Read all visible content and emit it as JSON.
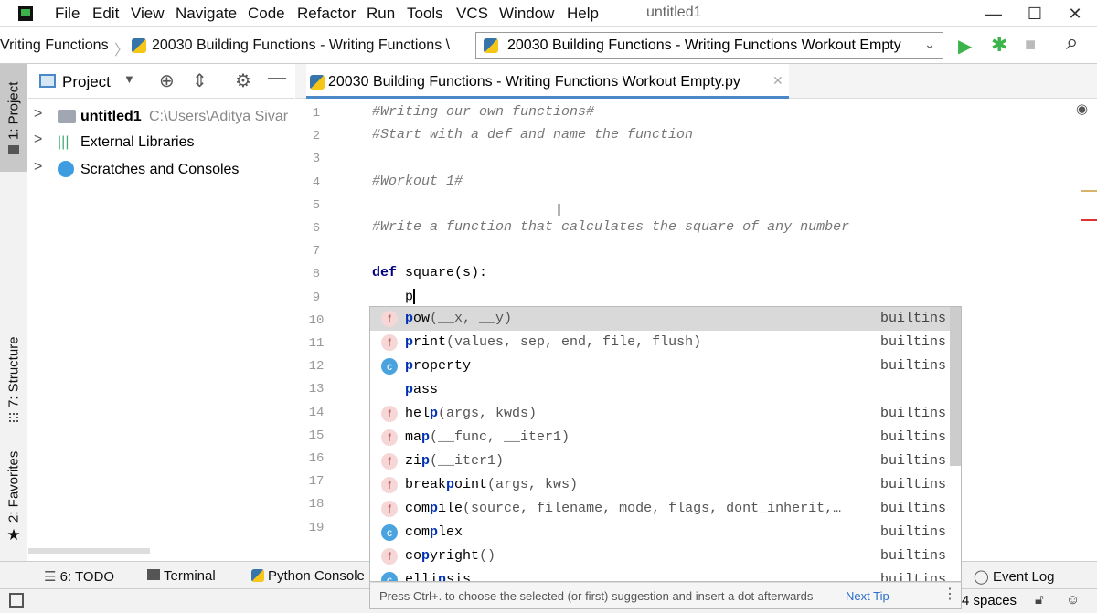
{
  "menubar": {
    "items": [
      "File",
      "Edit",
      "View",
      "Navigate",
      "Code",
      "Refactor",
      "Run",
      "Tools",
      "VCS",
      "Window",
      "Help"
    ],
    "window_title": "untitled1",
    "minimize": "—",
    "maximize": "☐",
    "close": "✕"
  },
  "navbar": {
    "crumb1": "Vriting Functions",
    "crumb2": "20030 Building Functions - Writing Functions \\",
    "run_config": "20030 Building Functions - Writing Functions Workout Empty",
    "run_icon": "▶",
    "debug_icon": "✱",
    "stop_icon": "■",
    "search_icon": "⌕"
  },
  "left_tabs": {
    "project": "1: Project",
    "structure": "7: Structure",
    "favorites": "2: Favorites"
  },
  "project_panel": {
    "title": "Project",
    "tree": [
      {
        "name": "untitled1",
        "path": "C:\\Users\\Aditya Sivar"
      },
      {
        "name": "External Libraries"
      },
      {
        "name": "Scratches and Consoles"
      }
    ]
  },
  "editor": {
    "tab_label": "20030 Building Functions - Writing Functions Workout Empty.py",
    "line_numbers": [
      "1",
      "2",
      "3",
      "4",
      "5",
      "6",
      "7",
      "8",
      "9",
      "10",
      "11",
      "12",
      "13",
      "14",
      "15",
      "16",
      "17",
      "18",
      "19"
    ],
    "lines": {
      "l1": "#Writing our own functions#",
      "l2": "#Start with a def and name the function",
      "l4": "#Workout 1#",
      "l6": "#Write a function that calculates the square of any number",
      "l8_kw": "def",
      "l8_rest": " square(s):",
      "l9": "    p"
    }
  },
  "completion": {
    "items": [
      {
        "badge": "f",
        "name_pre": "",
        "match": "p",
        "name_post": "ow",
        "args": "(__x, __y)",
        "source": "builtins"
      },
      {
        "badge": "f",
        "name_pre": "",
        "match": "p",
        "name_post": "rint",
        "args": "(values, sep, end, file, flush)",
        "source": "builtins"
      },
      {
        "badge": "c",
        "name_pre": "",
        "match": "p",
        "name_post": "roperty",
        "args": "",
        "source": "builtins"
      },
      {
        "badge": "",
        "name_pre": "",
        "match": "p",
        "name_post": "ass",
        "args": "",
        "source": ""
      },
      {
        "badge": "f",
        "name_pre": "hel",
        "match": "p",
        "name_post": "",
        "args": "(args, kwds)",
        "source": "builtins"
      },
      {
        "badge": "f",
        "name_pre": "ma",
        "match": "p",
        "name_post": "",
        "args": "(__func, __iter1)",
        "source": "builtins"
      },
      {
        "badge": "f",
        "name_pre": "zi",
        "match": "p",
        "name_post": "",
        "args": "(__iter1)",
        "source": "builtins"
      },
      {
        "badge": "f",
        "name_pre": "break",
        "match": "p",
        "name_post": "oint",
        "args": "(args, kws)",
        "source": "builtins"
      },
      {
        "badge": "f",
        "name_pre": "com",
        "match": "p",
        "name_post": "ile",
        "args": "(source, filename, mode, flags, dont_inherit,…",
        "source": "builtins"
      },
      {
        "badge": "c",
        "name_pre": "com",
        "match": "p",
        "name_post": "lex",
        "args": "",
        "source": "builtins"
      },
      {
        "badge": "f",
        "name_pre": "co",
        "match": "p",
        "name_post": "yright",
        "args": "()",
        "source": "builtins"
      },
      {
        "badge": "c",
        "name_pre": "elli",
        "match": "p",
        "name_post": "sis",
        "args": "",
        "source": "builtins"
      }
    ],
    "footer_text": "Press Ctrl+. to choose the selected (or first) suggestion and insert a dot afterwards",
    "next_tip": "Next Tip"
  },
  "bottom_tools": {
    "todo": "6: TODO",
    "terminal": "Terminal",
    "python_console": "Python Console",
    "event_log": "Event Log"
  },
  "status": {
    "indent": "4 spaces"
  }
}
